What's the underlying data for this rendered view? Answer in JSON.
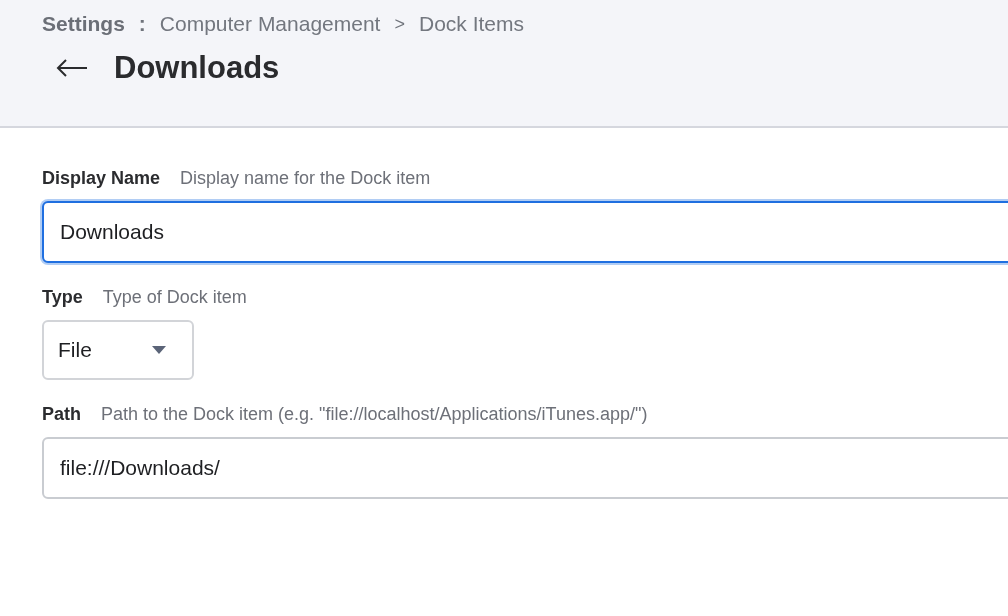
{
  "breadcrumb": [
    {
      "label": "Settings",
      "current": true,
      "separator": ":"
    },
    {
      "label": "Computer Management",
      "current": false,
      "separator": ">"
    },
    {
      "label": "Dock Items",
      "current": false
    }
  ],
  "page_title": "Downloads",
  "fields": [
    {
      "kind": "text",
      "label": "Display Name",
      "hint": "Display name for the Dock item",
      "value": "Downloads",
      "focused": true
    },
    {
      "kind": "select",
      "label": "Type",
      "hint": "Type of Dock item",
      "value": "File",
      "focused": false
    },
    {
      "kind": "text",
      "label": "Path",
      "hint": "Path to the Dock item (e.g. \"file://localhost/Applications/iTunes.app/\")",
      "value": "file:///Downloads/",
      "focused": false
    }
  ]
}
